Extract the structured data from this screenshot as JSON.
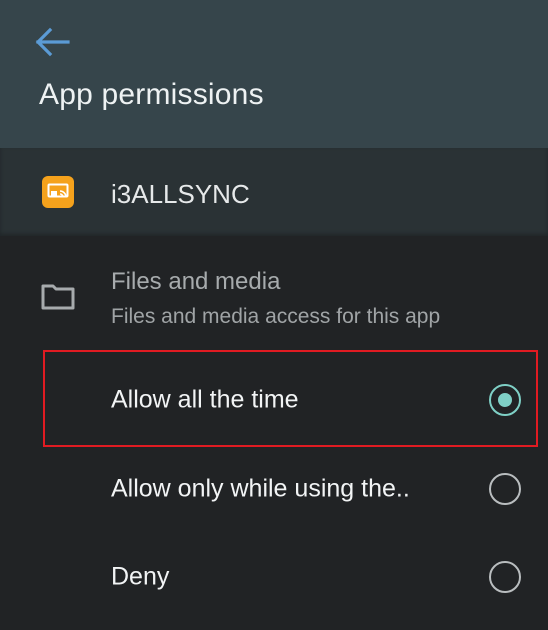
{
  "header": {
    "back_icon": "arrow-left-icon",
    "title": "App permissions",
    "background": "#36454b",
    "accent": "#5b9bd5"
  },
  "app": {
    "icon": "screen-cast-icon",
    "icon_color": "#f5a21c",
    "name": "i3ALLSYNC"
  },
  "permission": {
    "icon": "folder-icon",
    "title": "Files and media",
    "subtitle": "Files and media access for this app"
  },
  "options": [
    {
      "label": "Allow all the time",
      "selected": true
    },
    {
      "label": "Allow only while using the..",
      "selected": false
    },
    {
      "label": "Deny",
      "selected": false
    }
  ],
  "colors": {
    "radio_selected": "#7fd0c6",
    "highlight": "#e11b22"
  }
}
